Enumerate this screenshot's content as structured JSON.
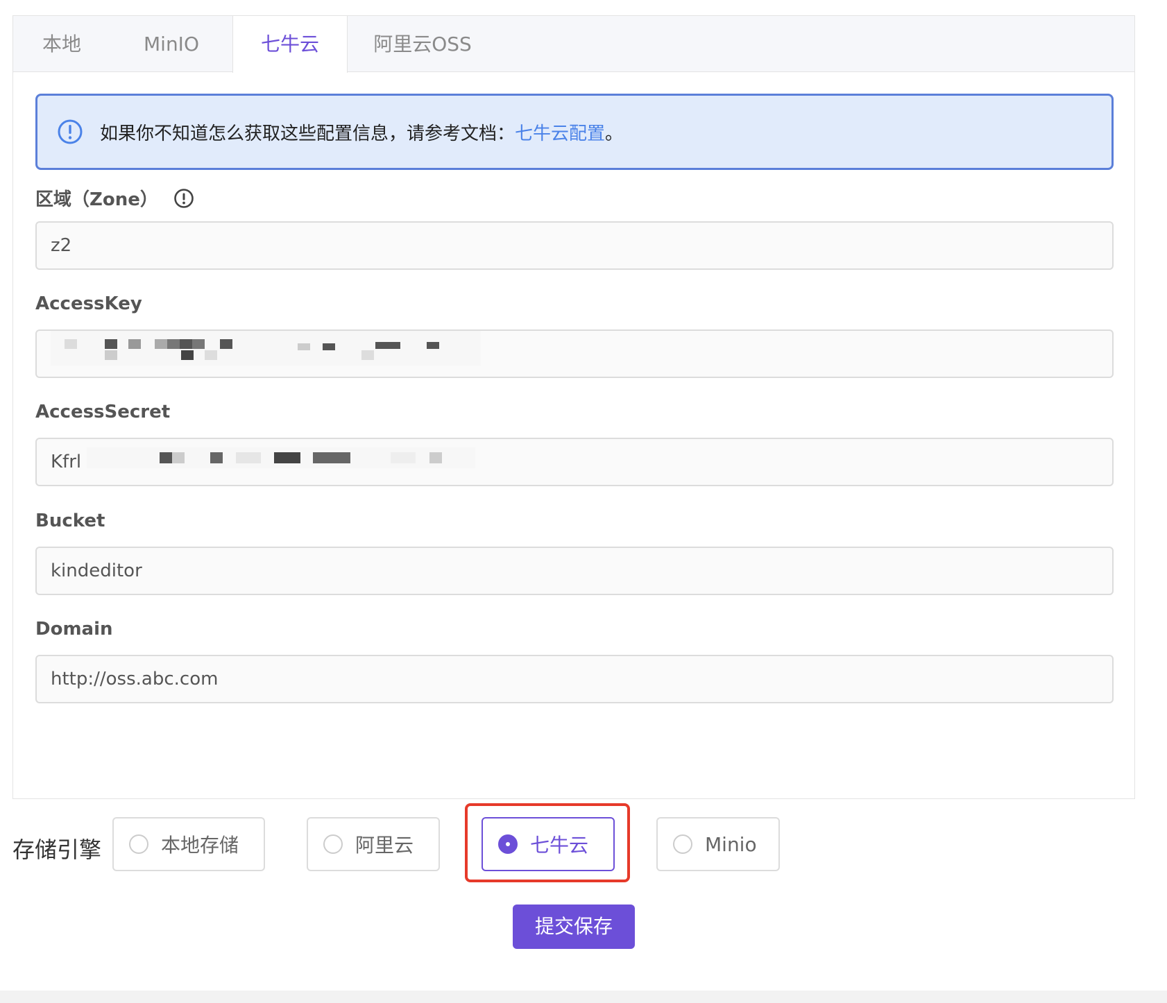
{
  "tabs": [
    "本地",
    "MinIO",
    "七牛云",
    "阿里云OSS"
  ],
  "active_tab": "七牛云",
  "alert": {
    "message": "如果你不知道怎么获取这些配置信息，请参考文档：",
    "link": "七牛云配置",
    "tail": "。"
  },
  "fields": {
    "zone": {
      "label": "区域（Zone）",
      "value": "z2"
    },
    "access_key": {
      "label": "AccessKey",
      "value": ""
    },
    "access_secret": {
      "label": "AccessSecret",
      "value": "Kfrl"
    },
    "bucket": {
      "label": "Bucket",
      "value": "kindeditor"
    },
    "domain": {
      "label": "Domain",
      "value": "http://oss.abc.com"
    }
  },
  "engine": {
    "label": "存储引擎",
    "options": [
      "本地存储",
      "阿里云",
      "七牛云",
      "Minio"
    ],
    "selected": "七牛云"
  },
  "submit_label": "提交保存",
  "colors": {
    "accent": "#6c4fd8",
    "alert_border": "#5b7fd9",
    "alert_bg": "#e1ebfb",
    "link": "#4a82e8",
    "highlight": "#e63a2a"
  }
}
